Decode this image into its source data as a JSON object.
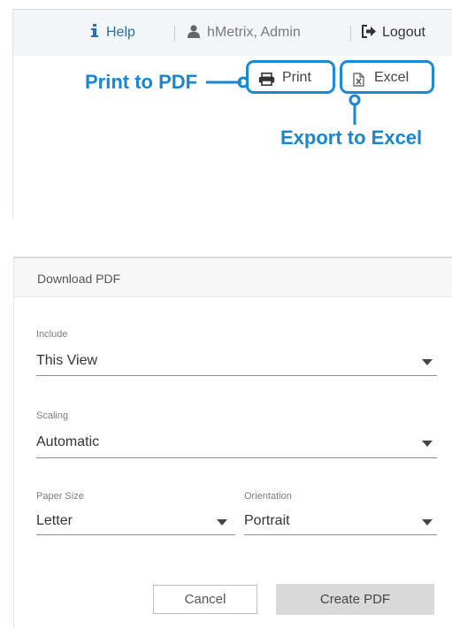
{
  "header": {
    "help_label": "Help",
    "user_label": "hMetrix, Admin",
    "logout_label": "Logout"
  },
  "toolbar": {
    "print_label": "Print",
    "excel_label": "Excel"
  },
  "callouts": {
    "print_to_pdf": "Print to PDF",
    "export_to_excel": "Export to Excel"
  },
  "dialog": {
    "title": "Download PDF",
    "include": {
      "label": "Include",
      "value": "This View"
    },
    "scaling": {
      "label": "Scaling",
      "value": "Automatic"
    },
    "paper_size": {
      "label": "Paper Size",
      "value": "Letter"
    },
    "orientation": {
      "label": "Orientation",
      "value": "Portrait"
    },
    "cancel_label": "Cancel",
    "create_label": "Create PDF"
  },
  "colors": {
    "callout_blue": "#1a86cf",
    "help_blue": "#2a6fb0",
    "header_bg": "#f3f6f9",
    "create_button_bg": "#d9d9d9"
  },
  "icons": {
    "help": "info-icon",
    "user": "user-icon",
    "logout": "logout-icon",
    "print": "printer-icon",
    "excel": "excel-file-icon"
  }
}
